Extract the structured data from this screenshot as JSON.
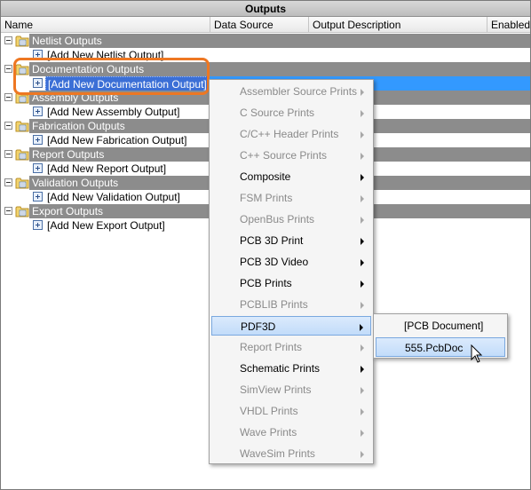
{
  "window": {
    "title": "Outputs"
  },
  "columns": [
    "Name",
    "Data Source",
    "Output Description",
    "Enabled"
  ],
  "groups": [
    {
      "label": "Netlist Outputs",
      "add_item": "[Add New Netlist Output]"
    },
    {
      "label": "Documentation Outputs",
      "add_item": "[Add New Documentation Output]"
    },
    {
      "label": "Assembly Outputs",
      "add_item": "[Add New Assembly Output]"
    },
    {
      "label": "Fabrication Outputs",
      "add_item": "[Add New Fabrication Output]"
    },
    {
      "label": "Report Outputs",
      "add_item": "[Add New Report Output]"
    },
    {
      "label": "Validation Outputs",
      "add_item": "[Add New Validation Output]"
    },
    {
      "label": "Export Outputs",
      "add_item": "[Add New Export Output]"
    }
  ],
  "context_menu": {
    "items": [
      {
        "label": "Assembler Source Prints",
        "enabled": false
      },
      {
        "label": "C Source Prints",
        "enabled": false
      },
      {
        "label": "C/C++ Header Prints",
        "enabled": false
      },
      {
        "label": "C++ Source Prints",
        "enabled": false
      },
      {
        "label": "Composite",
        "enabled": true
      },
      {
        "label": "FSM Prints",
        "enabled": false
      },
      {
        "label": "OpenBus Prints",
        "enabled": false
      },
      {
        "label": "PCB 3D Print",
        "enabled": true
      },
      {
        "label": "PCB 3D Video",
        "enabled": true
      },
      {
        "label": "PCB Prints",
        "enabled": true
      },
      {
        "label": "PCBLIB Prints",
        "enabled": false
      },
      {
        "label": "PDF3D",
        "enabled": true
      },
      {
        "label": "Report Prints",
        "enabled": false
      },
      {
        "label": "Schematic Prints",
        "enabled": true
      },
      {
        "label": "SimView Prints",
        "enabled": false
      },
      {
        "label": "VHDL Prints",
        "enabled": false
      },
      {
        "label": "Wave Prints",
        "enabled": false
      },
      {
        "label": "WaveSim Prints",
        "enabled": false
      }
    ],
    "hovered": "PDF3D"
  },
  "submenu": {
    "items": [
      "[PCB Document]",
      "555.PcbDoc"
    ],
    "hovered": "555.PcbDoc"
  },
  "colors": {
    "group_band": "#8c8c8c",
    "selection": "#3399ff",
    "highlight_ring": "#ee7722",
    "menu_hover": "#c2dcfa"
  }
}
